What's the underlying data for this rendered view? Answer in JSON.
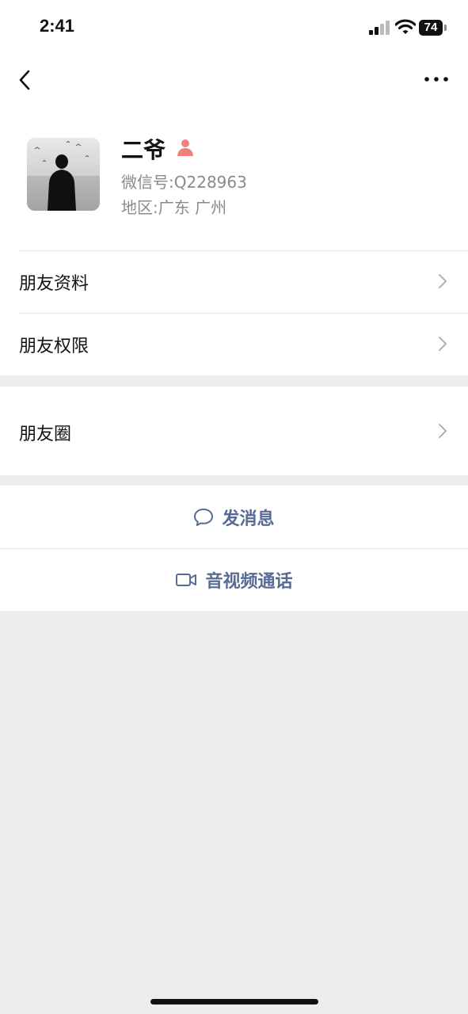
{
  "status_bar": {
    "time": "2:41",
    "battery": "74"
  },
  "profile": {
    "name": "二爷",
    "wechat_id_label": "微信号:",
    "wechat_id": "Q228963",
    "region_label": "地区:",
    "region": "广东 广州"
  },
  "menu": {
    "group1": [
      "朋友资料",
      "朋友权限"
    ],
    "group2": [
      "朋友圈"
    ]
  },
  "actions": {
    "message": "发消息",
    "call": "音视频通话"
  },
  "colors": {
    "link": "#576b95",
    "background": "#ededed",
    "person_icon": "#f08080"
  }
}
